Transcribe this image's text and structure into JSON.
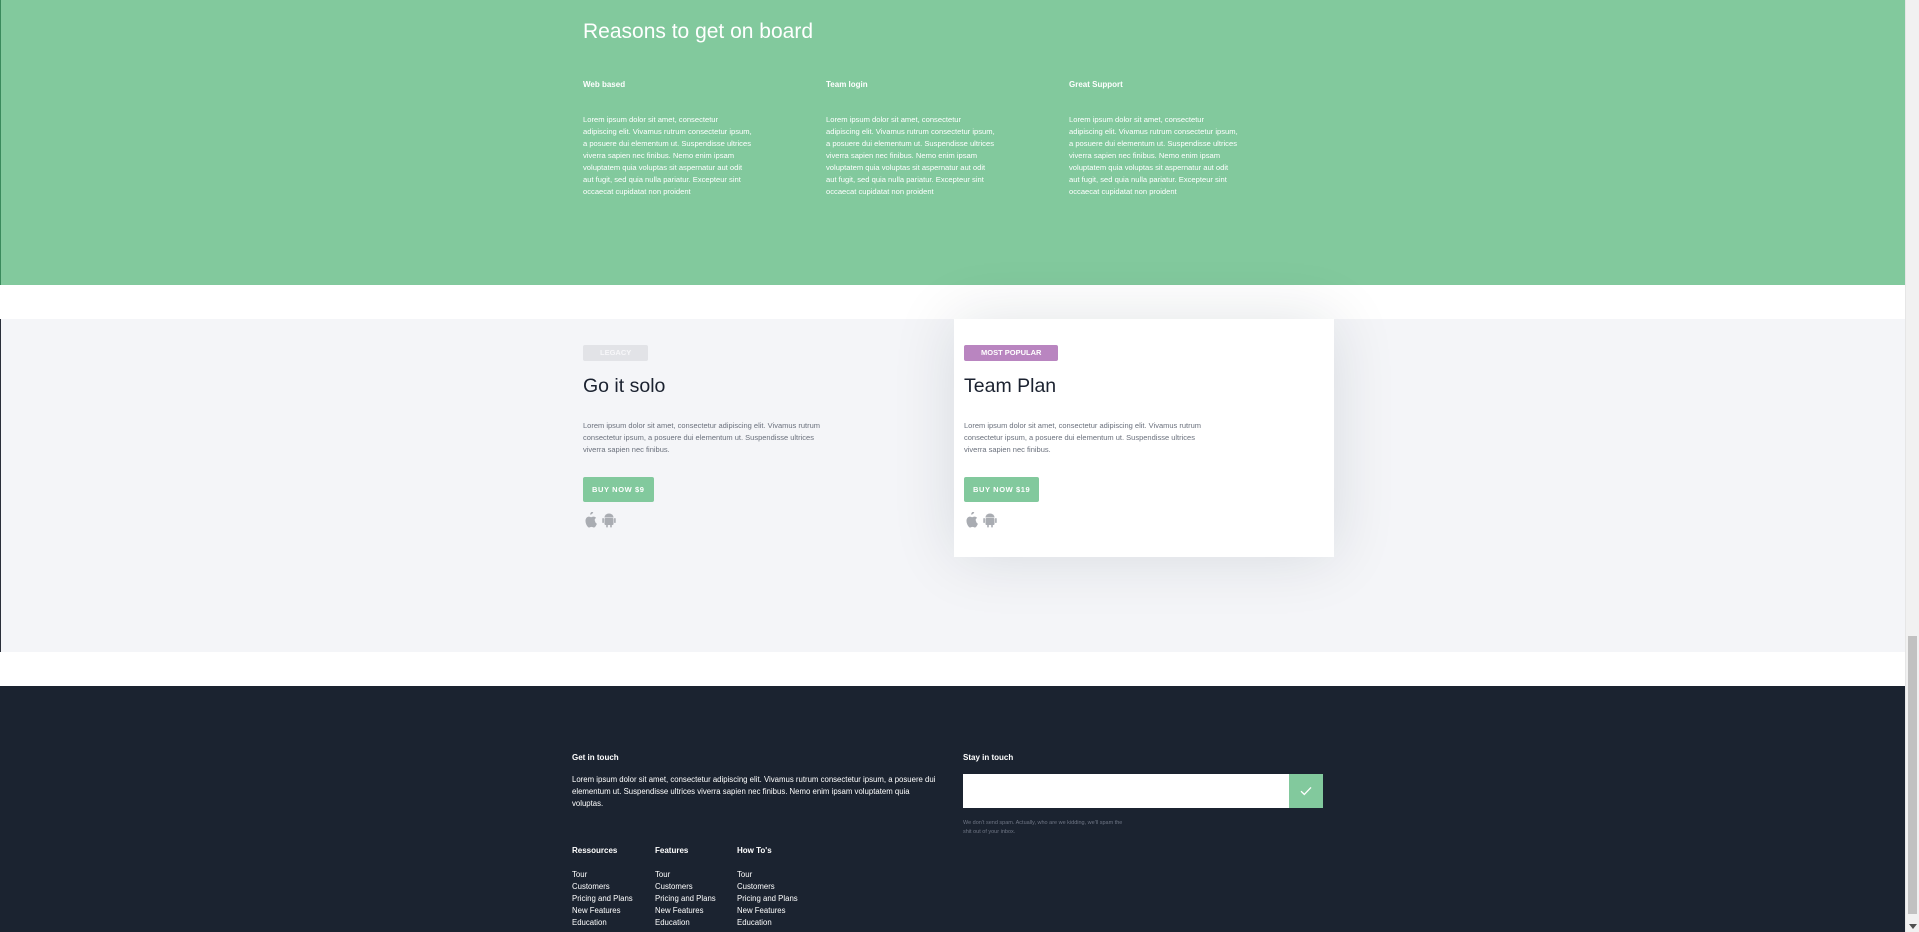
{
  "reasons": {
    "title": "Reasons to get on board",
    "items": [
      {
        "title": "Web based",
        "text": "Lorem ipsum dolor sit amet, consectetur adipiscing elit. Vivamus rutrum consectetur ipsum, a posuere dui elementum ut. Suspendisse ultrices viverra sapien nec finibus. Nemo enim ipsam voluptatem quia voluptas sit aspernatur aut odit aut fugit, sed quia nulla pariatur. Excepteur sint occaecat cupidatat non proident"
      },
      {
        "title": "Team login",
        "text": "Lorem ipsum dolor sit amet, consectetur adipiscing elit. Vivamus rutrum consectetur ipsum, a posuere dui elementum ut. Suspendisse ultrices viverra sapien nec finibus. Nemo enim ipsam voluptatem quia voluptas sit aspernatur aut odit aut fugit, sed quia nulla pariatur. Excepteur sint occaecat cupidatat non proident"
      },
      {
        "title": "Great Support",
        "text": "Lorem ipsum dolor sit amet, consectetur adipiscing elit. Vivamus rutrum consectetur ipsum, a posuere dui elementum ut. Suspendisse ultrices viverra sapien nec finibus. Nemo enim ipsam voluptatem quia voluptas sit aspernatur aut odit aut fugit, sed quia nulla pariatur. Excepteur sint occaecat cupidatat non proident"
      }
    ]
  },
  "plans": [
    {
      "badge": "Legacy",
      "name": "Go it solo",
      "description": "Lorem ipsum dolor sit amet, consectetur adipiscing elit. Vivamus rutrum consectetur ipsum, a posuere dui elementum ut. Suspendisse ultrices viverra sapien nec finibus.",
      "button": "BUY NOW $9"
    },
    {
      "badge": "Most Popular",
      "name": "Team Plan",
      "description": "Lorem ipsum dolor sit amet, consectetur adipiscing elit. Vivamus rutrum consectetur ipsum, a posuere dui elementum ut. Suspendisse ultrices viverra sapien nec finibus.",
      "button": "BUY NOW $19"
    }
  ],
  "footer": {
    "get_in_touch": {
      "title": "Get in touch",
      "text": "Lorem ipsum dolor sit amet, consectetur adipiscing elit. Vivamus rutrum consectetur ipsum, a posuere dui elementum ut. Suspendisse ultrices viverra sapien nec finibus. Nemo enim ipsam voluptatem quia voluptas."
    },
    "columns": [
      {
        "title": "Ressources",
        "links": [
          "Tour",
          "Customers",
          "Pricing and Plans",
          "New Features",
          "Education"
        ]
      },
      {
        "title": "Features",
        "links": [
          "Tour",
          "Customers",
          "Pricing and Plans",
          "New Features",
          "Education"
        ]
      },
      {
        "title": "How To's",
        "links": [
          "Tour",
          "Customers",
          "Pricing and Plans",
          "New Features",
          "Education"
        ]
      }
    ],
    "stay_in_touch": {
      "title": "Stay in touch",
      "email_placeholder": "",
      "disclaimer": "We don't send spam. Actually, who are we kidding, we'll spam the shit out of your inbox."
    }
  },
  "colors": {
    "green": "#82c99d",
    "purple_badge": "#b985c0",
    "footer_bg": "#1b2330",
    "pricing_bg": "#f4f5f8"
  },
  "icons": [
    "apple-icon",
    "android-icon",
    "checkmark-icon"
  ]
}
